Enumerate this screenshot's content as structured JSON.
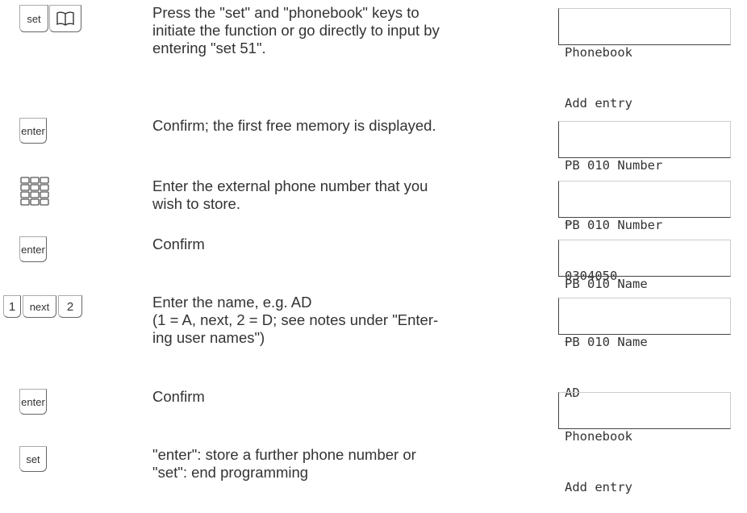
{
  "steps": [
    {
      "keys": [
        "set",
        "phonebook-icon"
      ],
      "text": [
        "Press the \"set\" and \"phonebook\" keys to",
        "initiate the function or go directly to input by",
        "entering \"set 51\"."
      ],
      "display": [
        "Phonebook",
        "Add entry"
      ]
    },
    {
      "keys": [
        "enter"
      ],
      "text": [
        "Confirm; the first free memory is displayed."
      ],
      "display": [
        "PB 010 Number",
        "_"
      ]
    },
    {
      "keys": [
        "keypad-icon"
      ],
      "text": [
        "Enter the external phone number that you",
        "wish to store."
      ],
      "display": [
        "PB 010 Number",
        "0304050"
      ]
    },
    {
      "keys": [
        "enter"
      ],
      "text": [
        "Confirm"
      ],
      "display": [
        "PB 010 Name",
        "_"
      ]
    },
    {
      "keys": [
        "1",
        "next",
        "2"
      ],
      "text": [
        "Enter the name, e.g. AD",
        "(1 = A, next, 2 = D; see notes under \"Enter-",
        "ing user names\")"
      ],
      "display": [
        "PB 010 Name",
        "AD"
      ]
    },
    {
      "keys": [
        "enter"
      ],
      "text": [
        "Confirm"
      ],
      "display": [
        "Phonebook",
        "Add entry"
      ]
    },
    {
      "keys": [
        "set"
      ],
      "text": [
        "\"enter\": store a further phone number or",
        "\"set\": end programming"
      ]
    }
  ]
}
